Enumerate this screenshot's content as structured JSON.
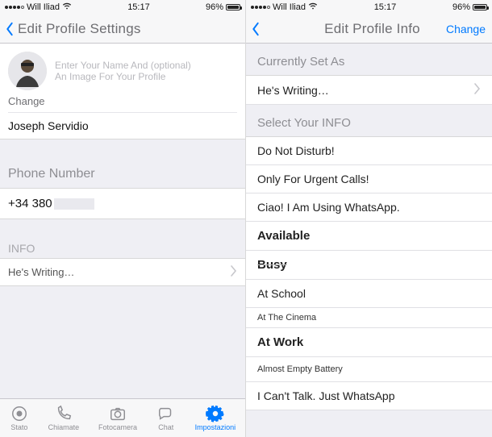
{
  "left": {
    "status": {
      "carrier": "Will Iliad",
      "time": "15:17",
      "battery": "96%"
    },
    "nav": {
      "title": "Edit Profile Settings"
    },
    "profile": {
      "placeholder_line1": "Enter Your Name And (optional)",
      "placeholder_line2": "An Image For Your Profile",
      "change_label": "Change",
      "name": "Joseph Servidio"
    },
    "phone": {
      "label": "Phone Number",
      "value": "+34 380"
    },
    "info": {
      "label": "INFO",
      "value": "He's Writing…"
    },
    "tabs": {
      "stato": "Stato",
      "chiamate": "Chiamate",
      "fotocamera": "Fotocamera",
      "chat": "Chat",
      "impostazioni": "Impostazioni"
    }
  },
  "right": {
    "status": {
      "carrier": "Will Iliad",
      "time": "15:17",
      "battery": "96%"
    },
    "nav": {
      "title": "Edit Profile Info",
      "change": "Change"
    },
    "current_header": "Currently Set As",
    "current_value": "He's Writing…",
    "select_header": "Select Your INFO",
    "options": [
      "Do Not Disturb!",
      "Only For Urgent Calls!",
      "Ciao! I Am Using WhatsApp.",
      "Available",
      "Busy",
      "At School",
      "At The Cinema",
      "At Work",
      "Almost Empty Battery",
      "I Can't Talk. Just WhatsApp"
    ]
  }
}
